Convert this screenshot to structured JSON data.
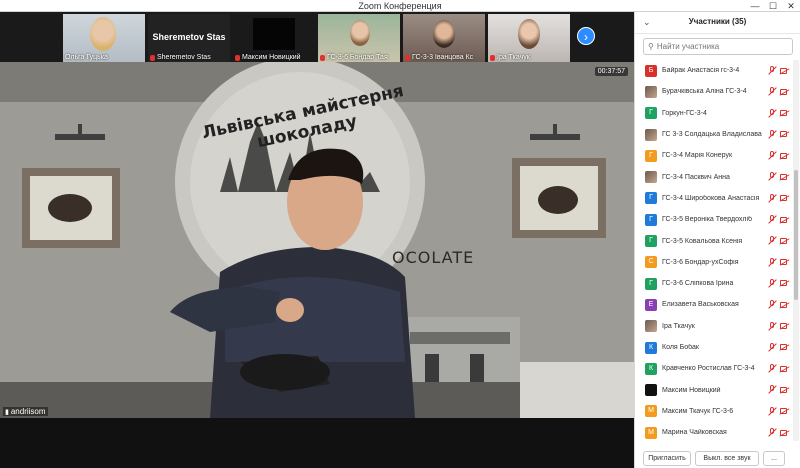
{
  "window": {
    "title": "Zoom Конференция",
    "controls": [
      "—",
      "☐",
      "✕"
    ]
  },
  "strip": {
    "thumbs": [
      {
        "label": "Ольга Гуцька",
        "mic_muted": false
      },
      {
        "label": "Sheremetov Stas",
        "name_big": "Sheremetov Stas",
        "mic_muted": false
      },
      {
        "label": "Максим Новицкий",
        "mic_muted": true
      },
      {
        "label": "ГС-3-6 Бондар Тая",
        "mic_muted": true
      },
      {
        "label": "ГС-3-3 Іванцова Кс",
        "mic_muted": true
      },
      {
        "label": "Іра Ткачук",
        "mic_muted": true
      }
    ],
    "next_icon": "arrow-right-icon"
  },
  "main_video": {
    "timer": "00:37:57",
    "speaker_name": "andriisom",
    "sign_text": "Львівська майстерня шоколаду",
    "sign_text2": "OCOLATE"
  },
  "sidebar": {
    "title": "Участники (35)",
    "search_placeholder": "Найти участника",
    "participants": [
      {
        "initial": "Б",
        "color": "#d9302c",
        "name": "Байрак Анастасія гс-3-4"
      },
      {
        "initial": "",
        "color": "photo",
        "name": "Бурачківська Аліна ГС-3-4"
      },
      {
        "initial": "Г",
        "color": "#1fa260",
        "name": "Горкун-ГС-3-4"
      },
      {
        "initial": "",
        "color": "photo",
        "name": "ГС 3-3 Солдацька Владислава"
      },
      {
        "initial": "Г",
        "color": "#f39b1f",
        "name": "ГС-3-4 Марія Конерук"
      },
      {
        "initial": "",
        "color": "photo",
        "name": "ГС-3-4 Пасквич Анна"
      },
      {
        "initial": "Г",
        "color": "#1f7ad9",
        "name": "ГС-3-4 Широбокова Анастасія"
      },
      {
        "initial": "Г",
        "color": "#1f7ad9",
        "name": "ГС-3-5 Вероніка Твердохліб"
      },
      {
        "initial": "Г",
        "color": "#1fa260",
        "name": "ГС-3-5 Ковальова Ксенія"
      },
      {
        "initial": "С",
        "color": "#f39b1f",
        "name": "ГС-3-6 Бондар-ухСофія"
      },
      {
        "initial": "Г",
        "color": "#1fa260",
        "name": "ГС-3-6 Сліпкова Ірина"
      },
      {
        "initial": "Е",
        "color": "#8a3fb5",
        "name": "Елизавета Васьковская"
      },
      {
        "initial": "",
        "color": "photo",
        "name": "Іра Ткачук"
      },
      {
        "initial": "К",
        "color": "#1f7ad9",
        "name": "Коля Бобак"
      },
      {
        "initial": "К",
        "color": "#1fa260",
        "name": "Кравченко Ростислав ГС-3-4"
      },
      {
        "initial": "",
        "color": "#111111",
        "name": "Максим Новицкий"
      },
      {
        "initial": "М",
        "color": "#f39b1f",
        "name": "Максим Ткачук ГС-3-6"
      },
      {
        "initial": "М",
        "color": "#f39b1f",
        "name": "Марина Чайковская"
      }
    ],
    "footer": {
      "invite": "Пригласить",
      "mute_all": "Выкл. все звук",
      "more": "..."
    }
  }
}
